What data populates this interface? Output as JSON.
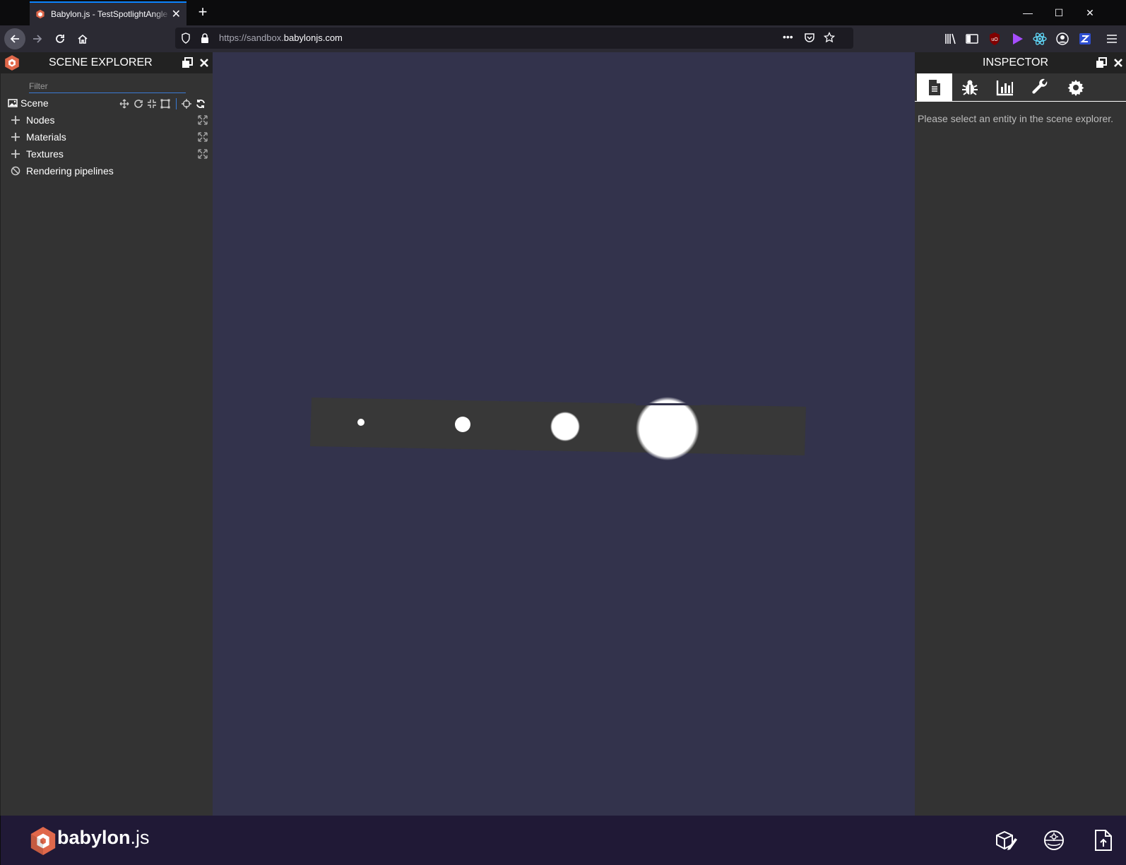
{
  "browser": {
    "tab_title": "Babylon.js - TestSpotlightAngle",
    "new_tab_label": "+",
    "url_prefix": "https://sandbox.",
    "url_domain": "babylonjs.com",
    "url_more": "•••",
    "window_buttons": {
      "minimize": "—",
      "maximize": "☐",
      "close": "✕"
    }
  },
  "explorer": {
    "title": "SCENE EXPLORER",
    "filter_placeholder": "Filter",
    "scene_label": "Scene",
    "items": [
      {
        "label": "Nodes",
        "icon": "plus-icon",
        "expandable": true
      },
      {
        "label": "Materials",
        "icon": "plus-icon",
        "expandable": true
      },
      {
        "label": "Textures",
        "icon": "plus-icon",
        "expandable": true
      },
      {
        "label": "Rendering pipelines",
        "icon": "ban-icon",
        "expandable": false
      }
    ]
  },
  "inspector": {
    "title": "INSPECTOR",
    "tabs": [
      "document-icon",
      "bug-icon",
      "chart-icon",
      "wrench-icon",
      "gear-icon"
    ],
    "active_tab": 0,
    "message": "Please select an entity in the scene explorer."
  },
  "scene": {
    "background_color": "#33334c",
    "plane_color": "#383838",
    "spot_count": 4
  },
  "footer": {
    "brand_main": "babylon",
    "brand_suffix": ".js"
  },
  "colors": {
    "brand_red": "#e0684b",
    "accent_blue": "#0a84ff"
  }
}
